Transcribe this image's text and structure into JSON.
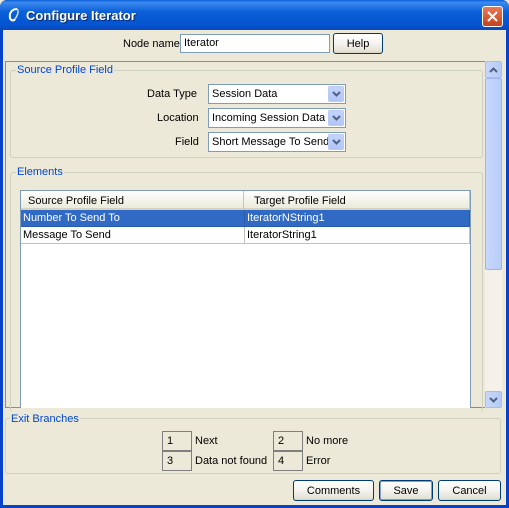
{
  "window": {
    "title": "Configure Iterator"
  },
  "node": {
    "label": "Node name",
    "value": "Iterator",
    "help_label": "Help"
  },
  "source_profile": {
    "title": "Source Profile Field",
    "data_type_label": "Data Type",
    "data_type_value": "Session Data",
    "location_label": "Location",
    "location_value": "Incoming Session Data",
    "field_label": "Field",
    "field_value": "Short Message To Send"
  },
  "elements": {
    "title": "Elements",
    "columns": [
      "Source Profile Field",
      "Target Profile Field"
    ],
    "rows": [
      {
        "source": "Number To Send To",
        "target": "IteratorNString1",
        "selected": true
      },
      {
        "source": "Message To Send",
        "target": "IteratorString1",
        "selected": false
      }
    ]
  },
  "exit_branches": {
    "title": "Exit Branches",
    "items": [
      {
        "number": "1",
        "label": "Next"
      },
      {
        "number": "2",
        "label": "No more"
      },
      {
        "number": "3",
        "label": "Data not found"
      },
      {
        "number": "4",
        "label": "Error"
      }
    ]
  },
  "buttons": {
    "comments": "Comments",
    "save": "Save",
    "cancel": "Cancel"
  },
  "icons": {
    "title": "app-icon",
    "close": "close-icon",
    "combo": "chevron-down-icon"
  },
  "colors": {
    "title_bar": "#0553d0",
    "selection": "#316ac5",
    "group_title": "#0046d5"
  }
}
